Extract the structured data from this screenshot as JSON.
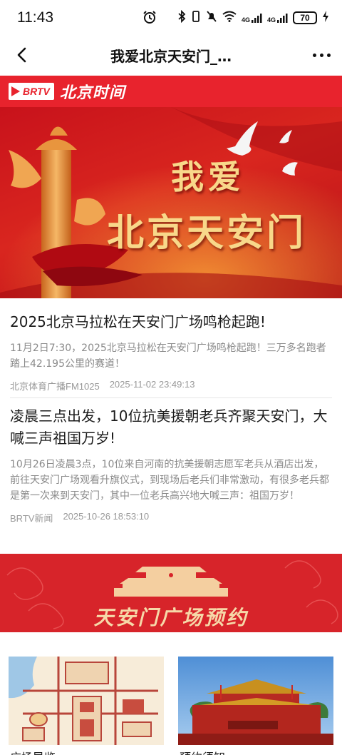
{
  "status": {
    "time": "11:43",
    "network1": "4G",
    "network2": "4G",
    "battery": "70"
  },
  "nav": {
    "title": "我爱北京天安门_…"
  },
  "brand": {
    "logo": "BRTV",
    "name": "北京时间"
  },
  "hero": {
    "line1": "我爱",
    "line2": "北京天安门"
  },
  "articles": [
    {
      "title": "2025北京马拉松在天安门广场鸣枪起跑!",
      "summary": "11月2日7:30，2025北京马拉松在天安门广场鸣枪起跑！三万多名跑者踏上42.195公里的赛道！",
      "source": "北京体育广播FM1025",
      "time": "2025-11-02 23:49:13"
    },
    {
      "title": "凌晨三点出发，10位抗美援朝老兵齐聚天安门，大喊三声祖国万岁!",
      "summary": "10月26日凌晨3点，10位来自河南的抗美援朝志愿军老兵从酒店出发，前往天安门广场观看升旗仪式，到现场后老兵们非常激动，有很多老兵都是第一次来到天安门，其中一位老兵高兴地大喊三声：祖国万岁！",
      "source": "BRTV新闻",
      "time": "2025-10-26 18:53:10"
    }
  ],
  "plaza": {
    "title": "天安门广场预约"
  },
  "cards": [
    {
      "caption": "广场导览"
    },
    {
      "caption": "预约须知"
    }
  ],
  "colors": {
    "brand_red": "#e8232d",
    "gold": "#f8d88a"
  }
}
